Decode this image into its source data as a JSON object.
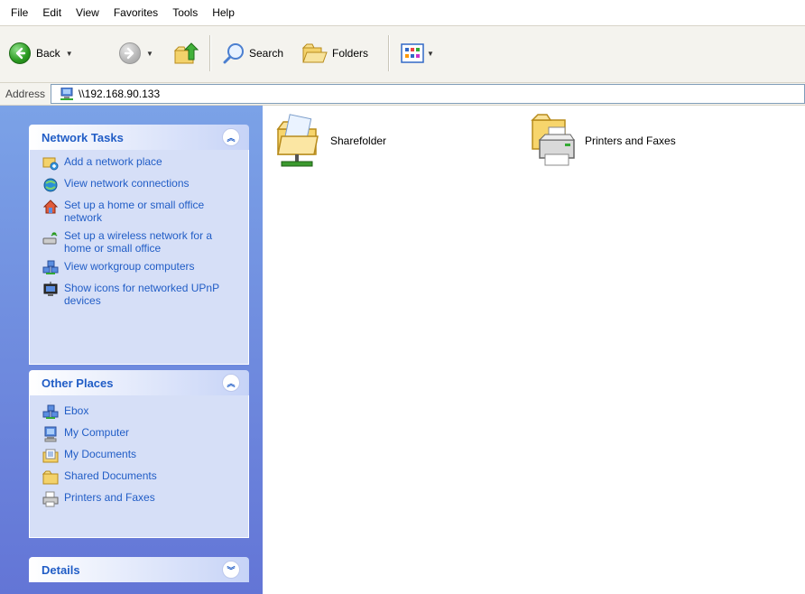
{
  "menu": [
    "File",
    "Edit",
    "View",
    "Favorites",
    "Tools",
    "Help"
  ],
  "toolbar": {
    "back_label": "Back",
    "search_label": "Search",
    "folders_label": "Folders"
  },
  "address": {
    "label": "Address",
    "value": "\\\\192.168.90.133"
  },
  "network_tasks": {
    "title": "Network Tasks",
    "items": [
      {
        "label": "Add a network place",
        "icon": "network-place-icon"
      },
      {
        "label": "View network connections",
        "icon": "network-connections-icon"
      },
      {
        "label": "Set up a home or small office network",
        "icon": "home-network-icon"
      },
      {
        "label": "Set up a wireless network for a home or small office",
        "icon": "wireless-network-icon"
      },
      {
        "label": "View workgroup computers",
        "icon": "workgroup-icon"
      },
      {
        "label": "Show icons for networked UPnP devices",
        "icon": "upnp-icon"
      }
    ]
  },
  "other_places": {
    "title": "Other Places",
    "items": [
      {
        "label": "Ebox",
        "icon": "workgroup-icon"
      },
      {
        "label": "My Computer",
        "icon": "computer-icon"
      },
      {
        "label": "My Documents",
        "icon": "documents-icon"
      },
      {
        "label": "Shared Documents",
        "icon": "folder-icon"
      },
      {
        "label": "Printers and Faxes",
        "icon": "printer-icon"
      }
    ]
  },
  "details": {
    "title": "Details"
  },
  "content": {
    "items": [
      {
        "label": "Sharefolder",
        "icon": "shared-folder-icon"
      },
      {
        "label": "Printers and Faxes",
        "icon": "printers-folder-icon"
      }
    ]
  }
}
